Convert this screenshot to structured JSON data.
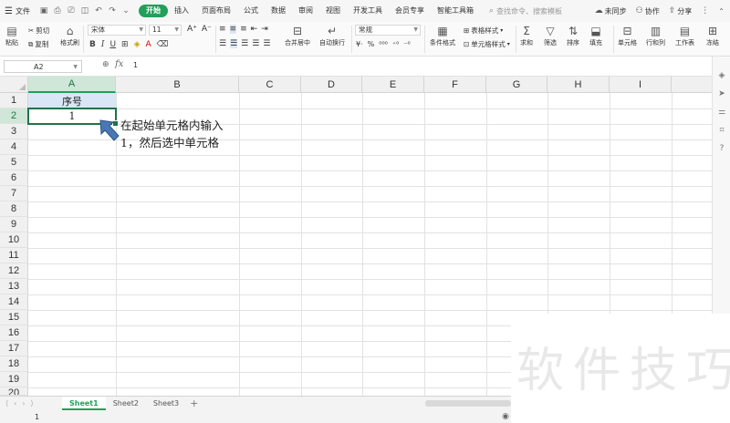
{
  "menubar": {
    "file_label": "文件",
    "tabs": [
      "开始",
      "插入",
      "页面布局",
      "公式",
      "数据",
      "审阅",
      "视图",
      "开发工具",
      "会员专享",
      "智能工具箱"
    ],
    "active_tab": "开始",
    "search_placeholder": "查找命令、搜索模板",
    "sync_label": "未同步",
    "collab_label": "协作",
    "share_label": "分享"
  },
  "ribbon": {
    "cut": "剪切",
    "paste": "粘贴",
    "copy": "复制",
    "format_painter": "格式刷",
    "font_name": "宋体",
    "font_size": "11",
    "merge": "合并居中",
    "wrap": "自动换行",
    "number_format": "常规",
    "cond_format": "条件格式",
    "table_style": "表格样式",
    "cell_style": "单元格样式",
    "sum": "求和",
    "filter": "筛选",
    "sort": "排序",
    "fill": "填充",
    "cell": "单元格",
    "row_col": "行和列",
    "worksheet": "工作表",
    "freeze": "冻结"
  },
  "formula_bar": {
    "name_box": "A2",
    "fx": "fx",
    "value": "1"
  },
  "columns": [
    "A",
    "B",
    "C",
    "D",
    "E",
    "F",
    "G",
    "H",
    "I"
  ],
  "rows": [
    "1",
    "2",
    "3",
    "4",
    "5",
    "6",
    "7",
    "8",
    "9",
    "10",
    "11",
    "12",
    "13",
    "14",
    "15",
    "16",
    "17",
    "18",
    "19",
    "20"
  ],
  "cells": {
    "A1": "序号",
    "A2": "1"
  },
  "annotation": {
    "line1": "在起始单元格内输入",
    "line2": "1，然后选中单元格"
  },
  "sheets": [
    "Sheet1",
    "Sheet2",
    "Sheet3"
  ],
  "active_sheet": "Sheet1",
  "status": {
    "value": "1"
  },
  "watermark": "软件技巧",
  "colors": {
    "accent": "#22a05a",
    "selection": "#217346",
    "header_fill": "#d9e6f5"
  }
}
